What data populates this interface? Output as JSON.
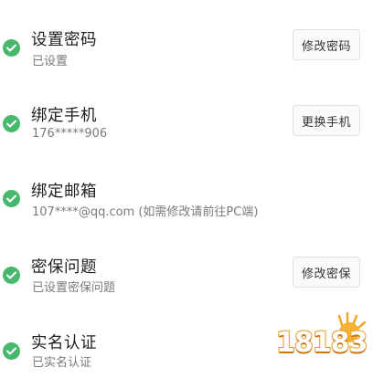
{
  "security_items": [
    {
      "title": "设置密码",
      "subtitle": "已设置",
      "button": "修改密码"
    },
    {
      "title": "绑定手机",
      "subtitle": "176*****906",
      "button": "更换手机"
    },
    {
      "title": "绑定邮箱",
      "subtitle": "107****@qq.com (如需修改请前往PC端)",
      "button": ""
    },
    {
      "title": "密保问题",
      "subtitle": "已设置密保问题",
      "button": "修改密保"
    },
    {
      "title": "实名认证",
      "subtitle": "已实名认证",
      "button": ""
    }
  ],
  "watermark": {
    "text": "18183"
  },
  "colors": {
    "check": "#47b86e",
    "title": "#1f1f1f",
    "subtitle": "#7a7a7a",
    "watermark_fill": "#ffffff",
    "watermark_stroke": "#e89a1c"
  },
  "icons": {
    "status": "check-circle-icon",
    "watermark": "18183-logo"
  }
}
